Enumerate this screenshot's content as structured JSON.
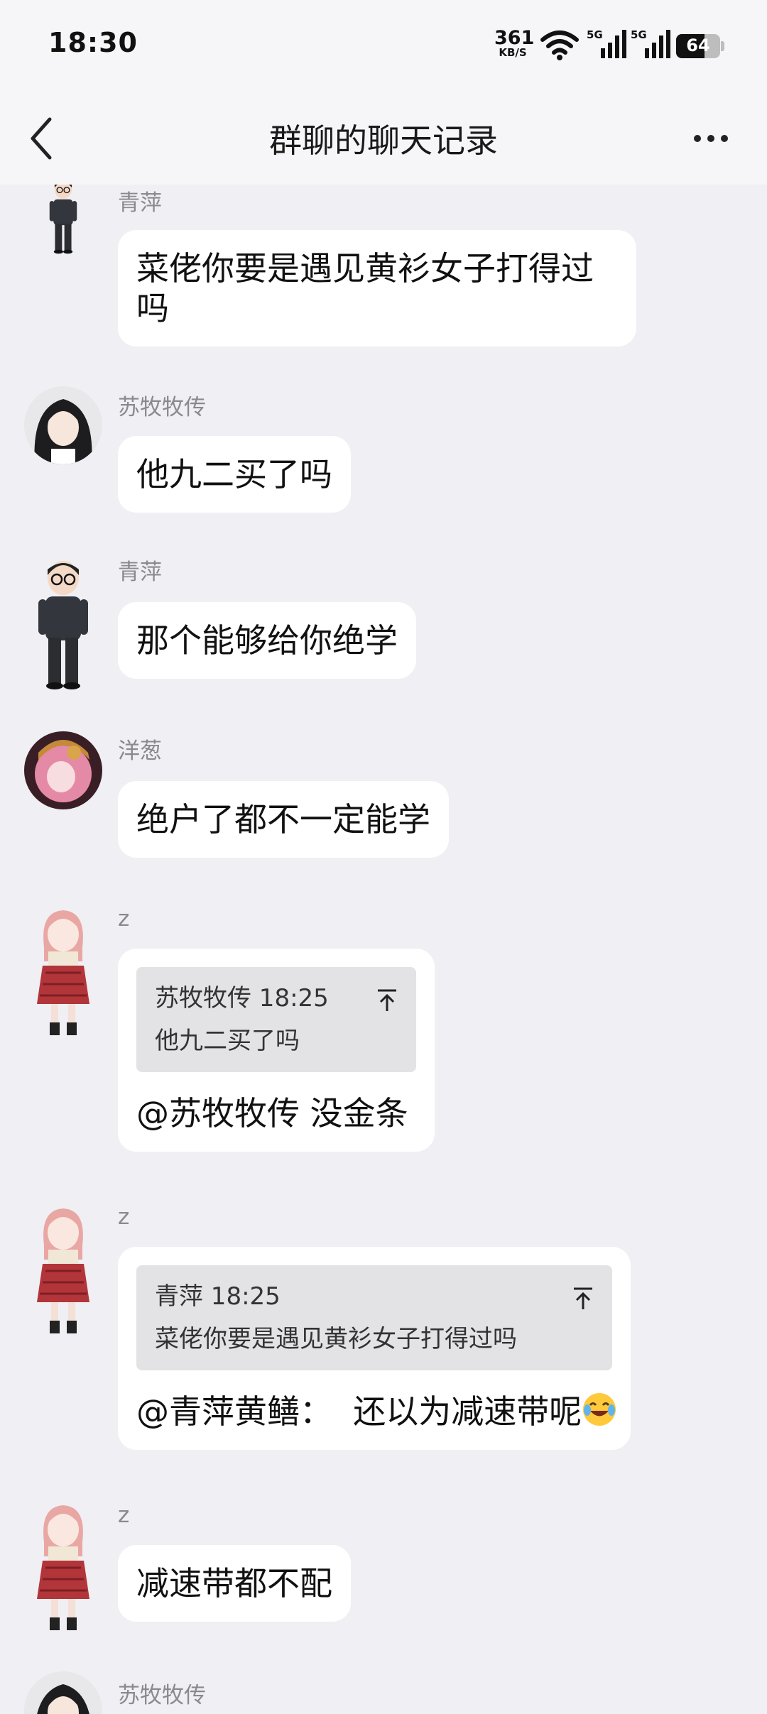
{
  "status_bar": {
    "time": "18:30",
    "net_speed_value": "361",
    "net_speed_unit": "KB/S",
    "signal_1_label": "5G",
    "signal_2_label": "5G",
    "battery_level": "64"
  },
  "header": {
    "title": "群聊的聊天记录"
  },
  "messages": [
    {
      "sender": "青萍",
      "avatar": "boy-glasses-avatar",
      "text_line1": "菜佬你要是遇见黄衫女子打得过",
      "text_line2": "吗"
    },
    {
      "sender": "苏牧牧传",
      "avatar": "long-hair-girl-avatar",
      "text": "他九二买了吗"
    },
    {
      "sender": "青萍",
      "avatar": "boy-glasses-avatar",
      "text": "那个能够给你绝学"
    },
    {
      "sender": "洋葱",
      "avatar": "pink-hair-anime-avatar",
      "text": "绝户了都不一定能学"
    },
    {
      "sender": "z",
      "avatar": "pink-hair-girl-avatar",
      "quote": {
        "header": "苏牧牧传 18:25",
        "text": "他九二买了吗"
      },
      "text": "@苏牧牧传 没金条"
    },
    {
      "sender": "z",
      "avatar": "pink-hair-girl-avatar",
      "quote": {
        "header": "青萍 18:25",
        "text": "菜佬你要是遇见黄衫女子打得过吗"
      },
      "text": "@青萍黄鳝：  还以为减速带呢",
      "emoji": "laugh-cry-emoji"
    },
    {
      "sender": "z",
      "avatar": "pink-hair-girl-avatar",
      "text": "减速带都不配"
    },
    {
      "sender": "苏牧牧传",
      "avatar": "long-hair-girl-avatar"
    }
  ]
}
